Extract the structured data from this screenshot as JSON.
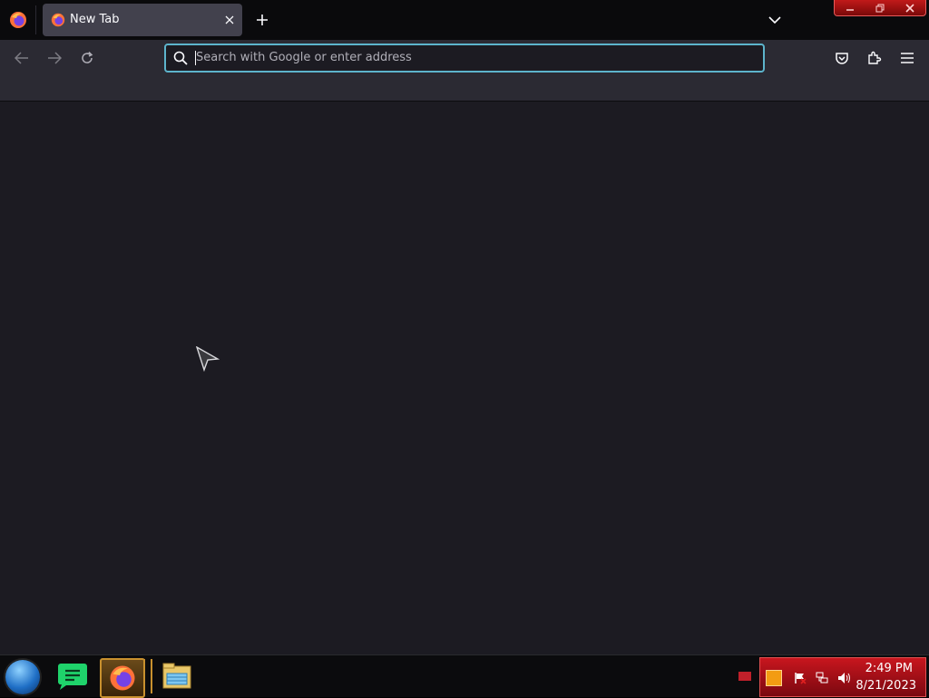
{
  "browser": {
    "app_icon": "firefox-icon",
    "tab": {
      "title": "New Tab",
      "favicon": "firefox-icon"
    },
    "urlbar": {
      "placeholder": "Search with Google or enter address"
    }
  },
  "taskbar": {
    "apps": [
      "start-orb",
      "messages-app-icon",
      "firefox-icon",
      "file-explorer-icon"
    ],
    "clock": {
      "time": "2:49 PM",
      "date": "8/21/2023"
    }
  },
  "colors": {
    "accent": "#5db4cc",
    "toolbar": "#2b2a33",
    "content": "#1c1b22",
    "tray": "#c8161e"
  }
}
